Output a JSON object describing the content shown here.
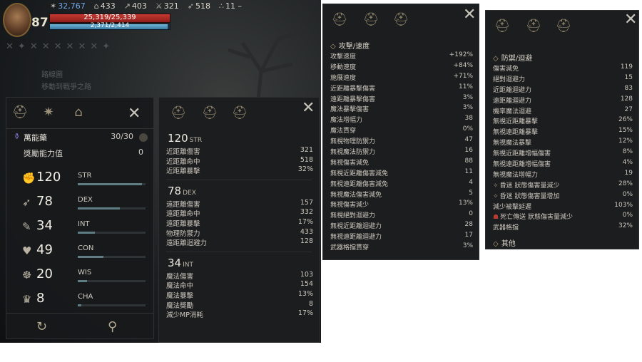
{
  "hud": {
    "level": "87",
    "stats": [
      {
        "icon": "feather-icon",
        "glyph": "✶",
        "value": "32,767",
        "highlight": true
      },
      {
        "icon": "helmet-icon",
        "glyph": "⌂",
        "value": "433",
        "highlight": false
      },
      {
        "icon": "boot-icon",
        "glyph": "↗",
        "value": "403",
        "highlight": false
      },
      {
        "icon": "sword-icon",
        "glyph": "⚔",
        "value": "321",
        "highlight": false
      },
      {
        "icon": "bow-icon",
        "glyph": "➶",
        "value": "518",
        "highlight": false
      },
      {
        "icon": "party-icon",
        "glyph": "∴",
        "value": "11 –",
        "highlight": false
      }
    ],
    "hp_text": "25,319/25,339",
    "hp_fraction": 0.999,
    "mp_text": "2,371/2,414",
    "mp_fraction": 0.982,
    "ghost_quest_1": "路線圖",
    "ghost_quest_2": "移動到戰爭之路"
  },
  "char_panel": {
    "item_name": "萬能藥",
    "item_count": "30/30",
    "reward_label": "獎勵能力值",
    "reward_value": "0",
    "stats": [
      {
        "name": "STR",
        "value": "120",
        "fill": 0.95
      },
      {
        "name": "DEX",
        "value": "78",
        "fill": 0.62
      },
      {
        "name": "INT",
        "value": "34",
        "fill": 0.25
      },
      {
        "name": "CON",
        "value": "49",
        "fill": 0.38
      },
      {
        "name": "WIS",
        "value": "20",
        "fill": 0.14
      },
      {
        "name": "CHA",
        "value": "8",
        "fill": 0.05
      }
    ]
  },
  "base_panel": {
    "groups": [
      {
        "value": "120",
        "unit": "STR",
        "rows": [
          {
            "label": "近距離傷害",
            "value": "321"
          },
          {
            "label": "近距離命中",
            "value": "518"
          },
          {
            "label": "近距離暴擊",
            "value": "32%"
          }
        ]
      },
      {
        "value": "78",
        "unit": "DEX",
        "rows": [
          {
            "label": "遠距離傷害",
            "value": "157"
          },
          {
            "label": "遠距離命中",
            "value": "332"
          },
          {
            "label": "遠距離暴擊",
            "value": "17%"
          },
          {
            "label": "物理防禦力",
            "value": "433"
          },
          {
            "label": "遠距離迴避力",
            "value": "128"
          }
        ]
      },
      {
        "value": "34",
        "unit": "INT",
        "rows": [
          {
            "label": "魔法傷害",
            "value": "103"
          },
          {
            "label": "魔法命中",
            "value": "154"
          },
          {
            "label": "魔法暴擊",
            "value": "13%"
          },
          {
            "label": "魔法獎勵",
            "value": "8"
          },
          {
            "label": "減少MP消耗",
            "value": "17%"
          }
        ]
      }
    ]
  },
  "attack_panel": {
    "section": "攻擊/速度",
    "rows": [
      {
        "label": "攻擊速度",
        "value": "+192%"
      },
      {
        "label": "移動速度",
        "value": "+84%"
      },
      {
        "label": "施展速度",
        "value": "+71%"
      },
      {
        "label": "近距離暴擊傷害",
        "value": "11%"
      },
      {
        "label": "遠距離暴擊傷害",
        "value": "3%"
      },
      {
        "label": "魔法暴擊傷害",
        "value": "3%"
      },
      {
        "label": "魔法增幅力",
        "value": "38"
      },
      {
        "label": "魔法貫穿",
        "value": "0%"
      },
      {
        "label": "無視物理防禦力",
        "value": "47"
      },
      {
        "label": "無視魔法防禦力",
        "value": "16"
      },
      {
        "label": "無視傷害減免",
        "value": "88"
      },
      {
        "label": "無視近距離傷害減免",
        "value": "11"
      },
      {
        "label": "無視遠距離傷害減免",
        "value": "4"
      },
      {
        "label": "無視魔法傷害減免",
        "value": "5"
      },
      {
        "label": "無視傷害減少",
        "value": "13%"
      },
      {
        "label": "無視絕對迴避力",
        "value": "0"
      },
      {
        "label": "無視近距離迴避力",
        "value": "28"
      },
      {
        "label": "無視遠距離迴避力",
        "value": "17"
      },
      {
        "label": "武器格擋貫穿",
        "value": "3%"
      }
    ]
  },
  "defense_panel": {
    "section": "防禦/迴避",
    "rows": [
      {
        "label": "傷害減免",
        "value": "119",
        "icon": ""
      },
      {
        "label": "絕對迴避力",
        "value": "15",
        "icon": ""
      },
      {
        "label": "近距離迴避力",
        "value": "83",
        "icon": ""
      },
      {
        "label": "遠距離迴避力",
        "value": "128",
        "icon": ""
      },
      {
        "label": "機率魔法迴避",
        "value": "27",
        "icon": ""
      },
      {
        "label": "無視近距離暴擊",
        "value": "26%",
        "icon": ""
      },
      {
        "label": "無視遠距離暴擊",
        "value": "15%",
        "icon": ""
      },
      {
        "label": "無視魔法暴擊",
        "value": "12%",
        "icon": ""
      },
      {
        "label": "無視近距離增幅傷害",
        "value": "8%",
        "icon": ""
      },
      {
        "label": "無視遠距離增幅傷害",
        "value": "4%",
        "icon": ""
      },
      {
        "label": "無視魔法增幅力",
        "value": "19",
        "icon": ""
      },
      {
        "label": "昏迷 狀態傷害量減少",
        "value": "28%",
        "icon": "stun-icon"
      },
      {
        "label": "昏迷 狀態傷害量增加",
        "value": "0%",
        "icon": "stun-icon"
      },
      {
        "label": "減少被擊延遲",
        "value": "103%",
        "icon": ""
      },
      {
        "label": "死亡傳送 狀態傷害量減少",
        "value": "0%",
        "icon": "death-icon"
      },
      {
        "label": "武器格擋",
        "value": "32%",
        "icon": ""
      }
    ],
    "footer_section": "其他"
  }
}
